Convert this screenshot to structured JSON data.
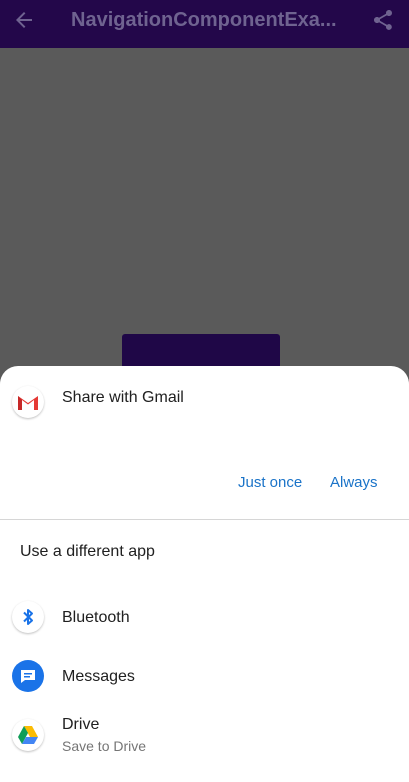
{
  "app_bar": {
    "title": "NavigationComponentExa...",
    "back_icon": "arrow-back-icon",
    "share_icon": "share-icon",
    "background": "#23074a"
  },
  "chooser": {
    "header": "Share with Gmail",
    "header_icon": "gmail-icon",
    "just_once_label": "Just once",
    "always_label": "Always",
    "different_app_label": "Use a different app",
    "accent": "#1a73c8",
    "apps": [
      {
        "label": "Bluetooth",
        "icon": "bluetooth-icon"
      },
      {
        "label": "Messages",
        "icon": "messages-icon"
      },
      {
        "label": "Drive",
        "subtitle": "Save to Drive",
        "icon": "drive-icon"
      }
    ]
  }
}
